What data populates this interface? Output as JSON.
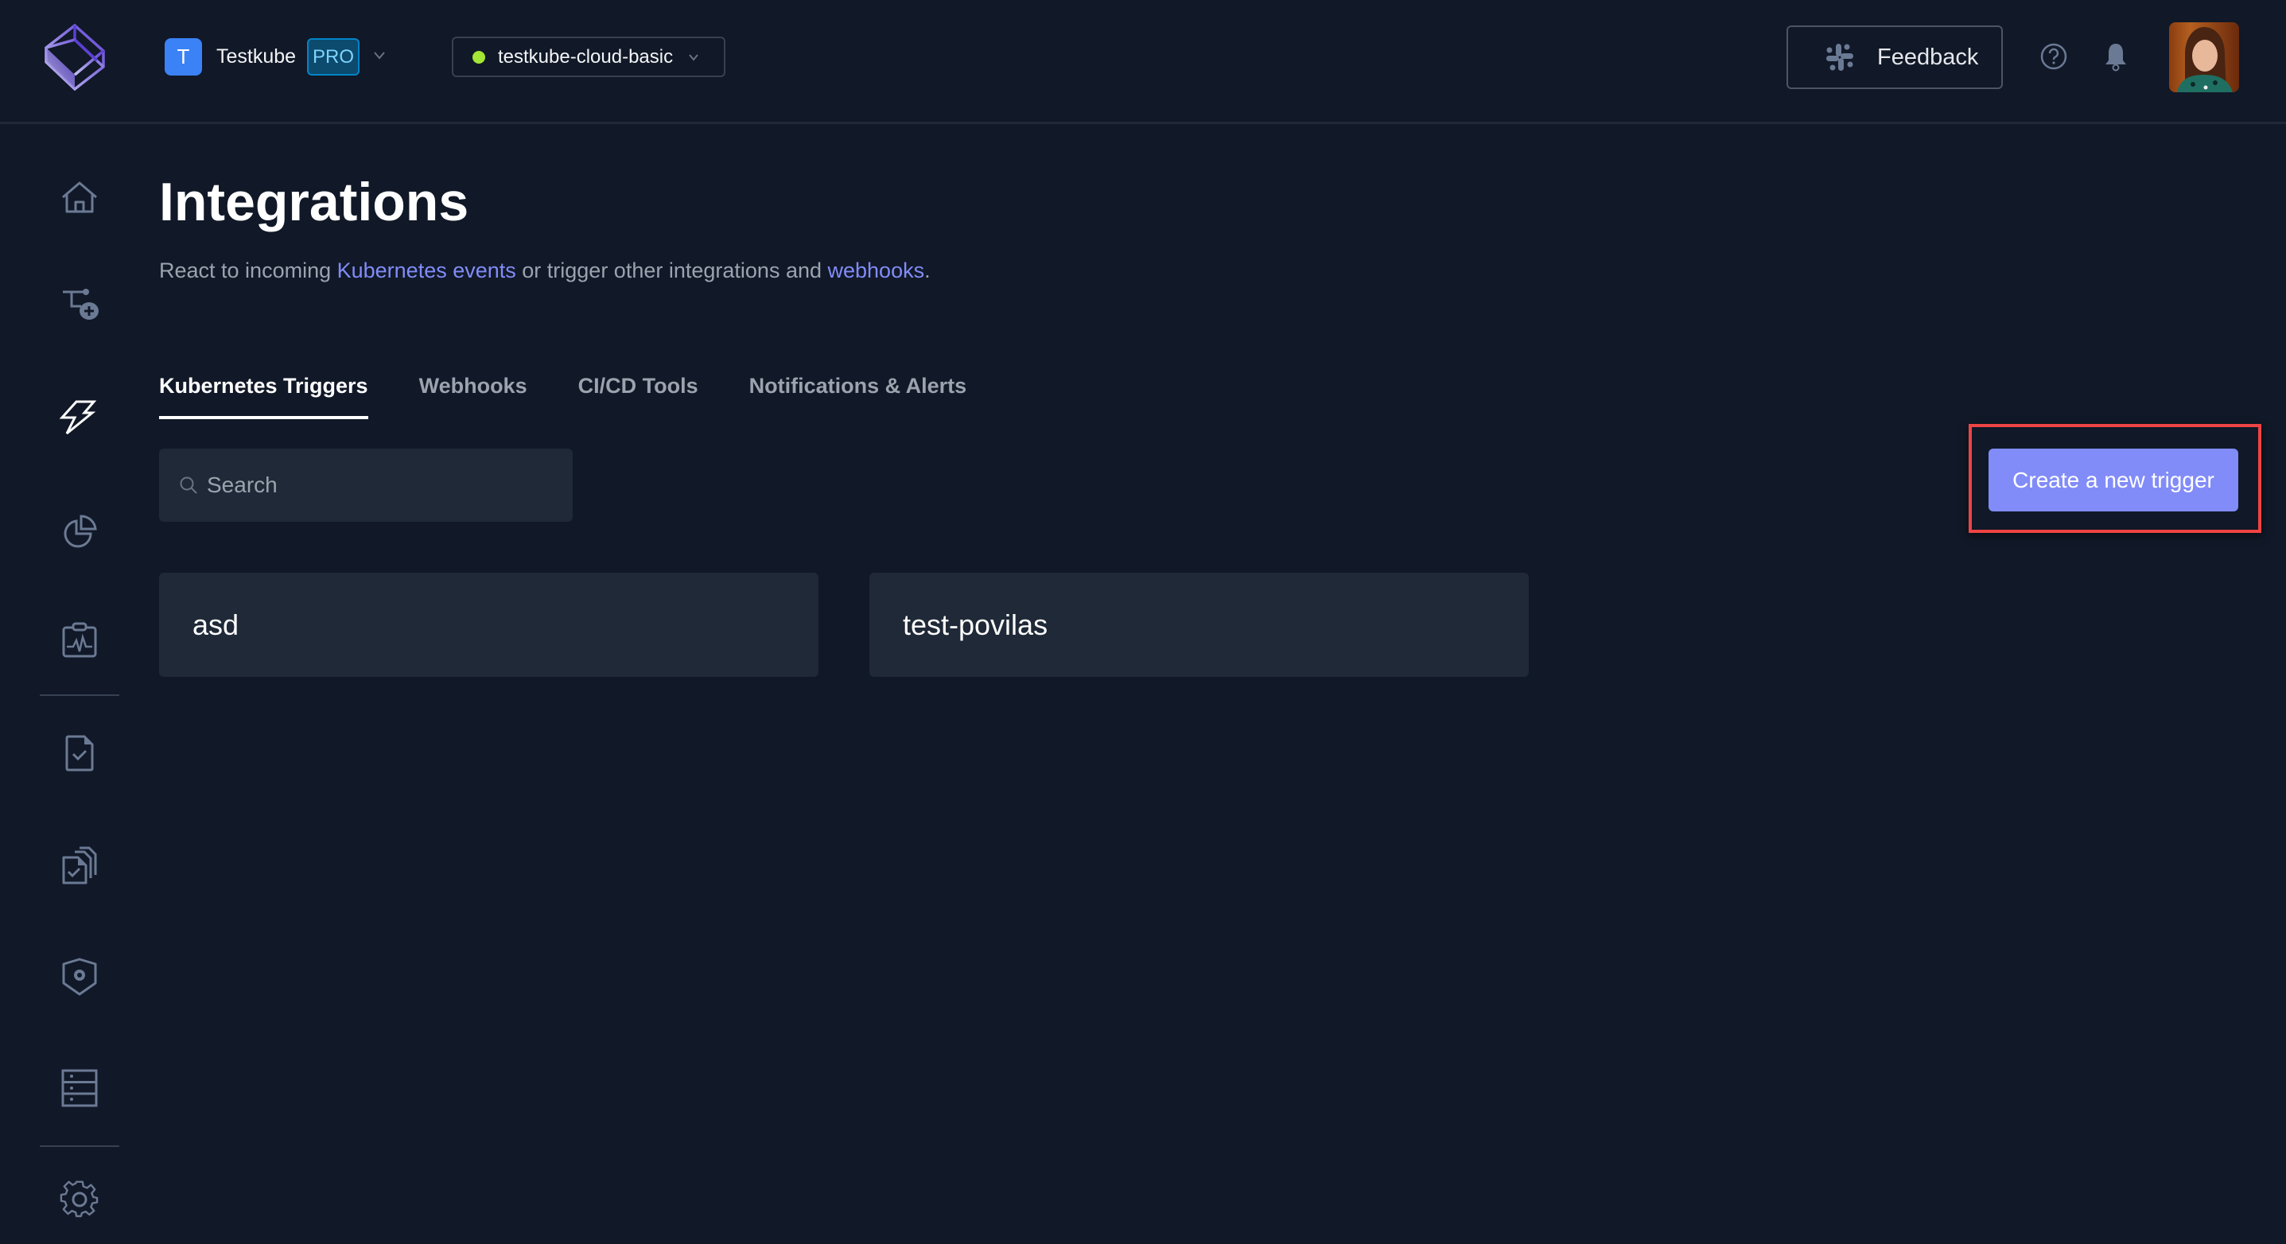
{
  "header": {
    "org": {
      "initial": "T",
      "name": "Testkube",
      "plan_badge": "PRO"
    },
    "environment": {
      "name": "testkube-cloud-basic",
      "status_color": "#a3e635"
    },
    "feedback_label": "Feedback"
  },
  "sidebar": {
    "items": [
      {
        "id": "home",
        "icon": "home-icon",
        "active": false
      },
      {
        "id": "add-test",
        "icon": "add-workflow-icon",
        "active": false
      },
      {
        "id": "integrations",
        "icon": "lightning-icon",
        "active": true
      },
      {
        "id": "analytics",
        "icon": "pie-chart-icon",
        "active": false
      },
      {
        "id": "reports",
        "icon": "clipboard-pulse-icon",
        "active": false
      },
      {
        "id": "tests",
        "icon": "file-check-icon",
        "active": false
      },
      {
        "id": "test-suites",
        "icon": "files-check-icon",
        "active": false
      },
      {
        "id": "security",
        "icon": "shield-gear-icon",
        "active": false
      },
      {
        "id": "executors",
        "icon": "server-icon",
        "active": false
      },
      {
        "id": "settings",
        "icon": "gear-icon",
        "active": false
      }
    ]
  },
  "page": {
    "title": "Integrations",
    "subtitle": {
      "prefix": "React to incoming ",
      "link1": "Kubernetes events",
      "middle": " or trigger other integrations and ",
      "link2": "webhooks",
      "suffix": "."
    },
    "tabs": [
      {
        "label": "Kubernetes Triggers",
        "active": true
      },
      {
        "label": "Webhooks",
        "active": false
      },
      {
        "label": "CI/CD Tools",
        "active": false
      },
      {
        "label": "Notifications & Alerts",
        "active": false
      }
    ],
    "search": {
      "placeholder": "Search",
      "value": ""
    },
    "create_button_label": "Create a new trigger",
    "triggers": [
      {
        "name": "asd"
      },
      {
        "name": "test-povilas"
      }
    ]
  },
  "colors": {
    "background": "#111827",
    "accent": "#818cf8",
    "highlight": "#ef4444",
    "card": "#1f2937"
  }
}
